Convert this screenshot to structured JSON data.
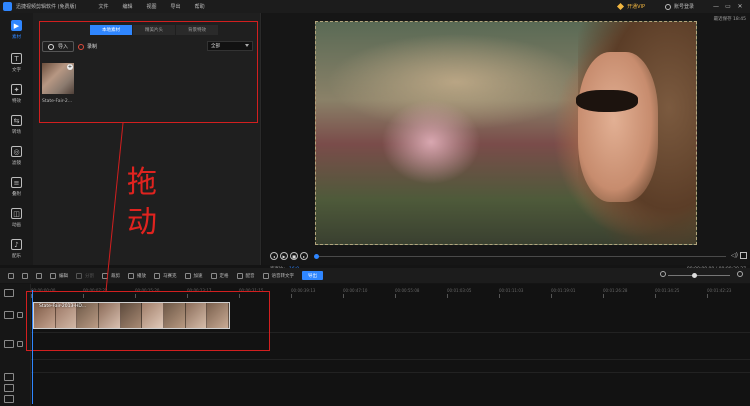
{
  "window": {
    "title": "迅捷视频剪辑软件 (免费版)",
    "menu": [
      "文件",
      "编辑",
      "视图",
      "导出",
      "帮助"
    ],
    "vip_label": "开通VIP",
    "login_label": "账号登录",
    "controls": [
      "—",
      "▭",
      "✕"
    ]
  },
  "sidebar": {
    "items": [
      {
        "label": "素材",
        "icon": "▶",
        "active": true
      },
      {
        "label": "文字",
        "icon": "T"
      },
      {
        "label": "特效",
        "icon": "✦"
      },
      {
        "label": "转场",
        "icon": "⇆"
      },
      {
        "label": "滤镜",
        "icon": "◎"
      },
      {
        "label": "叠附",
        "icon": "≡"
      },
      {
        "label": "动画",
        "icon": "◫"
      },
      {
        "label": "配乐",
        "icon": "♪"
      }
    ]
  },
  "media": {
    "tabs": [
      "本地素材",
      "精美片头",
      "背景特效"
    ],
    "import_label": "导入",
    "record_label": "录制",
    "filter_value": "全部",
    "thumb_name": "State-Fair-2..."
  },
  "preview": {
    "recent_save": "最近保存 18:45",
    "aspect_label": "宽高比:",
    "aspect_value": "16:9",
    "timecode": "00:00:00.00 / 00:00:30.27"
  },
  "toolbar": {
    "items": [
      {
        "label": "编辑",
        "enabled": true
      },
      {
        "label": "分割",
        "enabled": false
      },
      {
        "label": "裁剪",
        "enabled": true
      },
      {
        "label": "播放",
        "enabled": true
      },
      {
        "label": "马赛克",
        "enabled": true
      },
      {
        "label": "加速",
        "enabled": true
      },
      {
        "label": "定格",
        "enabled": true
      },
      {
        "label": "配音",
        "enabled": true
      },
      {
        "label": "语音转文字",
        "enabled": true
      }
    ],
    "export_label": "导出"
  },
  "timeline": {
    "ticks": [
      "00:00:00:00",
      "00:00:07:22",
      "00:00:15:20",
      "00:00:23:17",
      "00:00:31:15",
      "00:00:39:13",
      "00:00:47:10",
      "00:00:55:08",
      "00:01:03:05",
      "00:01:11:03",
      "00:01:19:01",
      "00:01:26:28",
      "00:01:34:25",
      "00:01:42:23"
    ],
    "clip_label": "State-Fair-2013-HD..."
  },
  "annotation": {
    "text": "拖动"
  }
}
